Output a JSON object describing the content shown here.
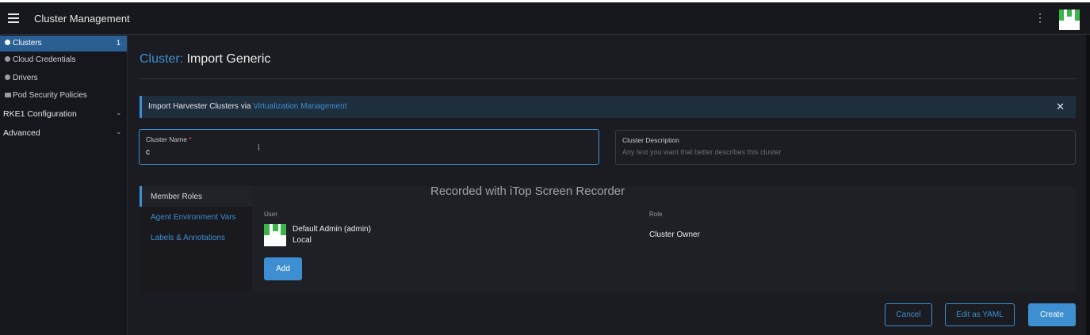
{
  "header": {
    "title": "Cluster Management"
  },
  "sidebar": {
    "items": [
      {
        "label": "Clusters",
        "count": "1"
      },
      {
        "label": "Cloud Credentials"
      },
      {
        "label": "Drivers"
      },
      {
        "label": "Pod Security Policies"
      }
    ],
    "groups": [
      {
        "label": "RKE1 Configuration"
      },
      {
        "label": "Advanced"
      }
    ]
  },
  "page": {
    "title_prefix": "Cluster:",
    "title": "Import Generic"
  },
  "banner": {
    "text": "Import Harvester Clusters via ",
    "link": "Virtualization Management",
    "close": "✕"
  },
  "form": {
    "name_label": "Cluster Name",
    "required_mark": "*",
    "name_value": "c",
    "desc_label": "Cluster Description",
    "desc_placeholder": "Any text you want that better describes this cluster"
  },
  "tabs": [
    "Member Roles",
    "Agent Environment Vars",
    "Labels & Annotations"
  ],
  "members": {
    "user_header": "User",
    "role_header": "Role",
    "user_name": "Default Admin (admin)",
    "user_provider": "Local",
    "role": "Cluster Owner",
    "add_label": "Add"
  },
  "watermark": "Recorded with iTop Screen Recorder",
  "footer": {
    "cancel": "Cancel",
    "yaml": "Edit as YAML",
    "create": "Create"
  },
  "colors": {
    "accent": "#3d8fd1",
    "active_nav": "#2a5f94",
    "logo_green": "#3bb54a"
  }
}
